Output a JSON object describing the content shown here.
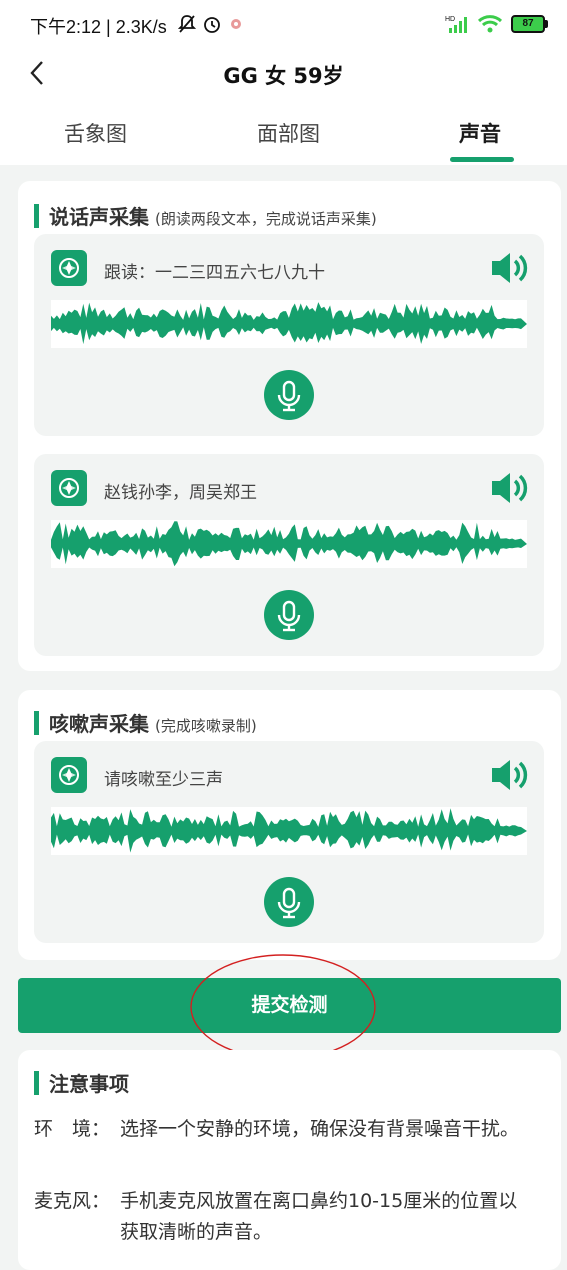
{
  "status_bar": {
    "time_speed": "下午2:12 | 2.3K/s",
    "battery": "87"
  },
  "header": {
    "title": "GG 女 59岁"
  },
  "tabs": [
    {
      "label": "舌象图",
      "active": false
    },
    {
      "label": "面部图",
      "active": false
    },
    {
      "label": "声音",
      "active": true
    }
  ],
  "speech_section": {
    "title": "说话声采集",
    "subtitle": "(朗读两段文本，完成说话声采集)",
    "recordings": [
      {
        "prompt": "跟读：一二三四五六七八九十"
      },
      {
        "prompt": "赵钱孙李，周吴郑王"
      }
    ]
  },
  "cough_section": {
    "title": "咳嗽声采集",
    "subtitle": "(完成咳嗽录制)",
    "recordings": [
      {
        "prompt": "请咳嗽至少三声"
      }
    ]
  },
  "submit_label": "提交检测",
  "notes": {
    "title": "注意事项",
    "items": [
      {
        "key": "环　境：",
        "value": "选择一个安静的环境，确保没有背景噪音干扰。"
      },
      {
        "key": "麦克风：",
        "value": "手机麦克风放置在离口鼻约10-15厘米的位置以获取清晰的声音。"
      }
    ]
  },
  "colors": {
    "accent": "#16a06d",
    "annotation": "#d32020"
  }
}
